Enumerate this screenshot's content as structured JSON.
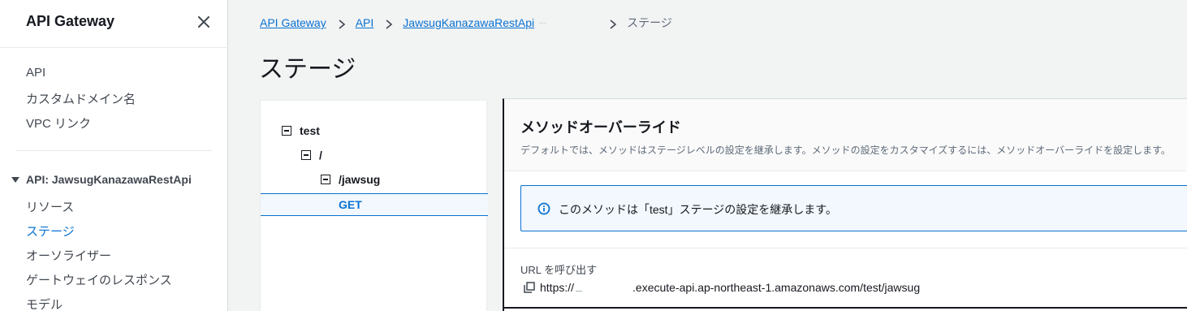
{
  "sidebar": {
    "title": "API Gateway",
    "top_links": [
      "API",
      "カスタムドメイン名",
      "VPC リンク"
    ],
    "section_title": "API: JawsugKanazawaRestApi",
    "section_links": [
      "リソース",
      "ステージ",
      "オーソライザー",
      "ゲートウェイのレスポンス",
      "モデル"
    ],
    "active_link": "ステージ"
  },
  "breadcrumb": {
    "items": [
      "API Gateway",
      "API",
      "JawsugKanazawaRestApi"
    ],
    "masked": "...",
    "current": "ステージ"
  },
  "page": {
    "title": "ステージ"
  },
  "tree": {
    "stage": "test",
    "root": "/",
    "resource": "/jawsug",
    "method": "GET"
  },
  "override": {
    "title": "メソッドオーバーライド",
    "description": "デフォルトでは、メソッドはステージレベルの設定を継承します。メソッドの設定をカスタマイズするには、メソッドオーバーライドを設定します。",
    "info_text": "このメソッドは「test」ステージの設定を継承します。",
    "url_label": "URL を呼び出す",
    "url_prefix": "https://",
    "url_suffix": ".execute-api.ap-northeast-1.amazonaws.com/test/jawsug"
  },
  "colors": {
    "link": "#0972d3",
    "text": "#16191f",
    "background": "#f2f3f3",
    "info_bg": "#f2f8fd"
  }
}
